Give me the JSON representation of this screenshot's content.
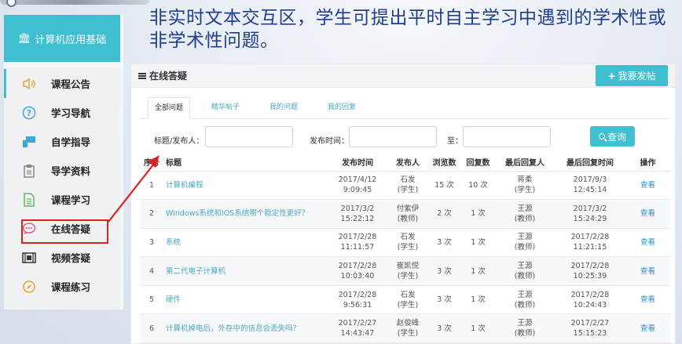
{
  "headline": "非实时文本交互区，学生可提出平时自主学习中遇到的学术性或非学术性问题。",
  "sidebar": {
    "course_title": "计算机应用基础",
    "items": [
      {
        "label": "课程公告",
        "icon": "speaker-icon",
        "color": "#e8a23a"
      },
      {
        "label": "学习导航",
        "icon": "question-circle-icon",
        "color": "#3fa8d8"
      },
      {
        "label": "自学指导",
        "icon": "presentation-icon",
        "color": "#3fa8d8"
      },
      {
        "label": "导学资料",
        "icon": "clipboard-icon",
        "color": "#888888"
      },
      {
        "label": "课程学习",
        "icon": "document-icon",
        "color": "#5cb85c"
      },
      {
        "label": "在线答疑",
        "icon": "chat-bubble-icon",
        "color": "#e05a8a"
      },
      {
        "label": "视频答疑",
        "icon": "film-icon",
        "color": "#333333"
      },
      {
        "label": "课程练习",
        "icon": "compass-icon",
        "color": "#e8a23a"
      }
    ]
  },
  "panel": {
    "title": "在线答疑",
    "post_button": "我要发帖"
  },
  "tabs": [
    {
      "label": "全部问题",
      "active": true
    },
    {
      "label": "精华帖子",
      "active": false
    },
    {
      "label": "我的问题",
      "active": false
    },
    {
      "label": "我的回复",
      "active": false
    }
  ],
  "filter": {
    "title_label": "标题/发布人：",
    "time_label": "发布时间：",
    "to_label": "至：",
    "query_button": "查询"
  },
  "table": {
    "headers": [
      "序号",
      "标题",
      "发布时间",
      "发布人",
      "浏览数",
      "回复数",
      "最后回复人",
      "最后回复时间",
      "操作"
    ],
    "rows": [
      {
        "no": "1",
        "title": "计算机编程",
        "date": "2017/4/12",
        "time": "9:09:45",
        "author": "石发",
        "role": "(学生)",
        "views": "15 次",
        "replies": "10 次",
        "last_user": "蒋柔",
        "last_role": "(学生)",
        "last_date": "2017/9/3",
        "last_time": "12:45:14",
        "action": "查看"
      },
      {
        "no": "2",
        "title": "Windows系统和IOS系统哪个稳定性更好？",
        "date": "2017/3/2",
        "time": "15:22:12",
        "author": "付紫伊",
        "role": "(教师)",
        "views": "2 次",
        "replies": "1 次",
        "last_user": "王源",
        "last_role": "(教师)",
        "last_date": "2017/3/2",
        "last_time": "15:24:29",
        "action": "查看"
      },
      {
        "no": "3",
        "title": "系统",
        "date": "2017/2/28",
        "time": "11:11:57",
        "author": "石发",
        "role": "(学生)",
        "views": "3 次",
        "replies": "1 次",
        "last_user": "王源",
        "last_role": "(教师)",
        "last_date": "2017/2/28",
        "last_time": "11:21:15",
        "action": "查看"
      },
      {
        "no": "4",
        "title": "第二代电子计算机",
        "date": "2017/2/28",
        "time": "10:03:40",
        "author": "崔凯悦",
        "role": "(学生)",
        "views": "3 次",
        "replies": "1 次",
        "last_user": "王源",
        "last_role": "(教师)",
        "last_date": "2017/2/28",
        "last_time": "10:25:39",
        "action": "查看"
      },
      {
        "no": "5",
        "title": "硬件",
        "date": "2017/2/28",
        "time": "9:56:31",
        "author": "石发",
        "role": "(学生)",
        "views": "3 次",
        "replies": "1 次",
        "last_user": "王源",
        "last_role": "(教师)",
        "last_date": "2017/2/28",
        "last_time": "10:24:43",
        "action": "查看"
      },
      {
        "no": "6",
        "title": "计算机掉电后，外存中的信息会丢失吗？",
        "date": "2017/2/27",
        "time": "14:43:47",
        "author": "赵俊峰",
        "role": "(学生)",
        "views": "3 次",
        "replies": "1 次",
        "last_user": "王源",
        "last_role": "(教师)",
        "last_date": "2017/2/27",
        "last_time": "15:15:23",
        "action": "查看"
      }
    ]
  },
  "colors": {
    "accent": "#3fbfd0",
    "headline": "#1f3e8c",
    "highlight": "#e02020"
  }
}
